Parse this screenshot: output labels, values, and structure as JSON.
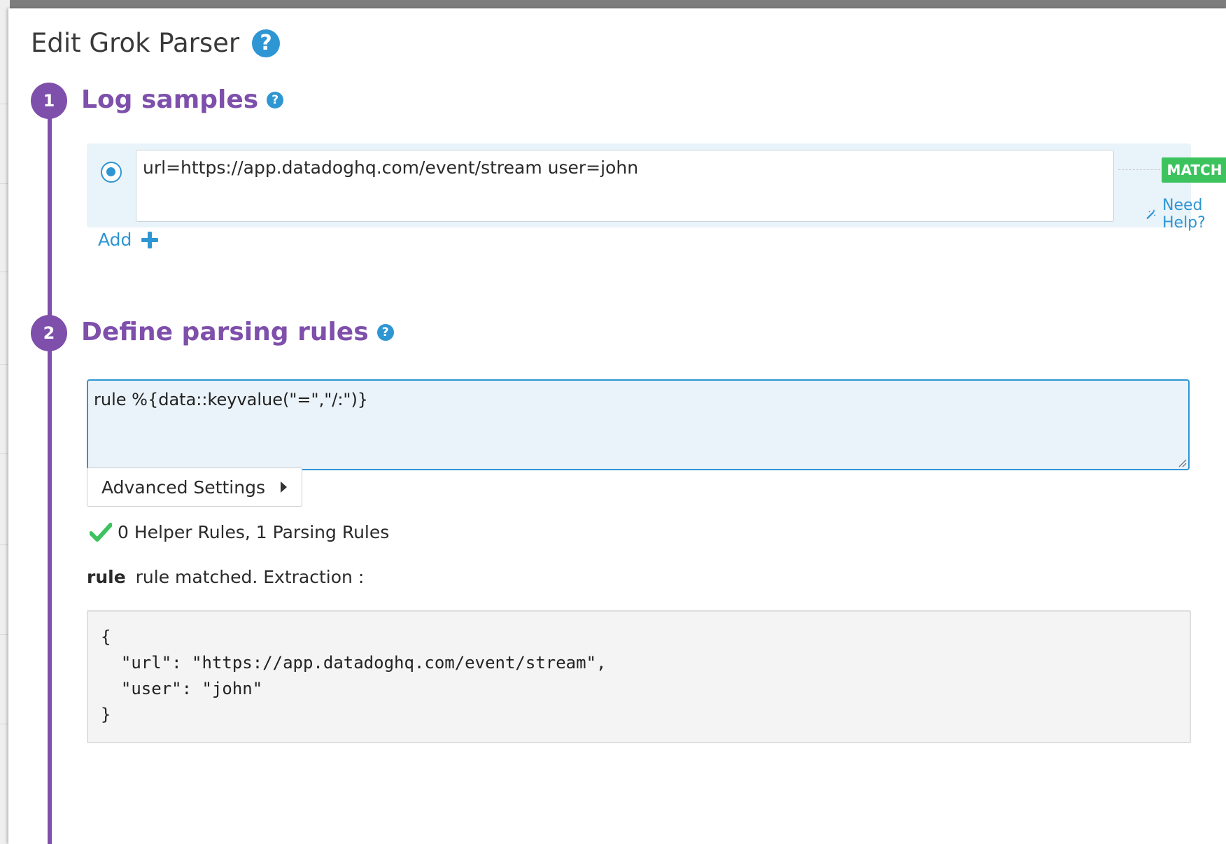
{
  "modal": {
    "title": "Edit Grok Parser",
    "help_glyph": "?"
  },
  "steps": [
    {
      "number": "1",
      "heading": "Log samples"
    },
    {
      "number": "2",
      "heading": "Define parsing rules"
    }
  ],
  "log_samples": {
    "sample_text": "url=https://app.datadoghq.com/event/stream user=john",
    "match_label": "MATCH",
    "need_help_label": "Need Help?",
    "add_label": "Add"
  },
  "parsing": {
    "rule_text": "rule %{data::keyvalue(\"=\",\"/:\")}",
    "advanced_settings_label": "Advanced Settings",
    "status_text": "0 Helper Rules, 1 Parsing Rules",
    "rule_name": "rule",
    "extraction_text": "rule matched. Extraction :",
    "extraction_json": "{\n  \"url\": \"https://app.datadoghq.com/event/stream\",\n  \"user\": \"john\"\n}"
  },
  "colors": {
    "accent_purple": "#7e4fab",
    "link_blue": "#2e96d3",
    "match_green": "#3cc35e",
    "check_green": "#3cc35e"
  },
  "icons": {
    "help": "question-circle-icon",
    "delete": "trash-icon",
    "need_help": "magic-wand-icon",
    "add": "plus-icon",
    "expand": "caret-right-icon",
    "status": "checkmark-icon"
  }
}
